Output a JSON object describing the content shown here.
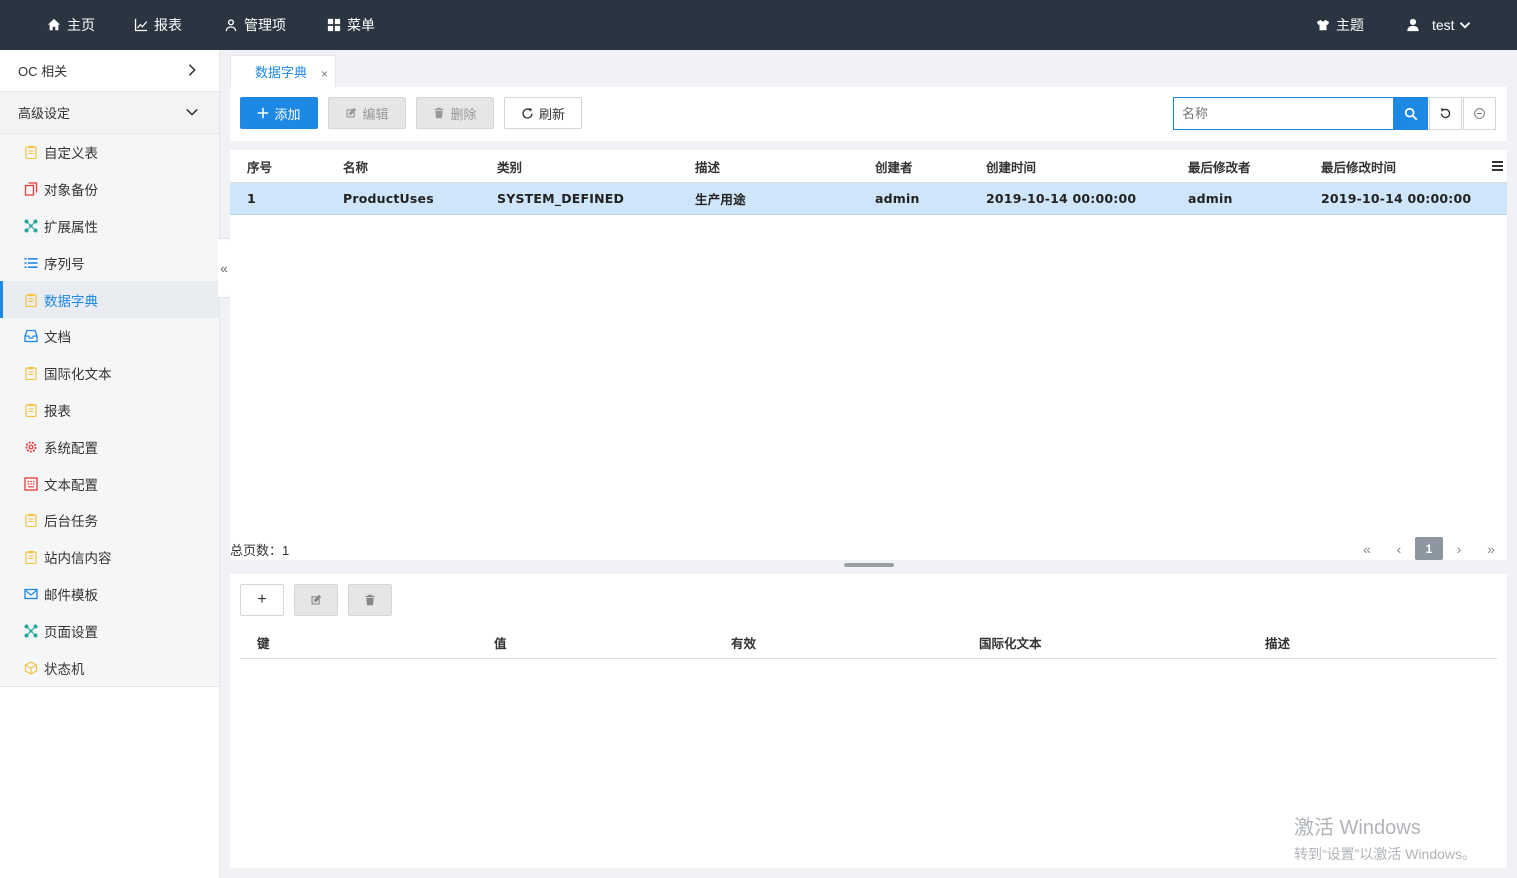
{
  "topnav": {
    "home": "主页",
    "reports": "报表",
    "admin": "管理项",
    "menu": "菜单",
    "theme": "主题",
    "user": "test"
  },
  "sidebar": {
    "group_oc": "OC 相关",
    "group_advanced": "高级设定",
    "items": [
      {
        "label": "自定义表",
        "icon": "clipboard-icon",
        "color": "#f5c242"
      },
      {
        "label": "对象备份",
        "icon": "copy-icon",
        "color": "#e53935"
      },
      {
        "label": "扩展属性",
        "icon": "network-icon",
        "color": "#26a69a"
      },
      {
        "label": "序列号",
        "icon": "list-icon",
        "color": "#1e88e5"
      },
      {
        "label": "数据字典",
        "icon": "clipboard-icon",
        "color": "#f5c242"
      },
      {
        "label": "文档",
        "icon": "inbox-icon",
        "color": "#1e88e5"
      },
      {
        "label": "国际化文本",
        "icon": "clipboard-icon",
        "color": "#f5c242"
      },
      {
        "label": "报表",
        "icon": "clipboard-icon",
        "color": "#f5c242"
      },
      {
        "label": "系统配置",
        "icon": "gear-icon",
        "color": "#e53935"
      },
      {
        "label": "文本配置",
        "icon": "keyboard-icon",
        "color": "#e53935"
      },
      {
        "label": "后台任务",
        "icon": "clipboard-icon",
        "color": "#f5c242"
      },
      {
        "label": "站内信内容",
        "icon": "clipboard-icon",
        "color": "#f5c242"
      },
      {
        "label": "邮件模板",
        "icon": "mail-icon",
        "color": "#1e88e5"
      },
      {
        "label": "页面设置",
        "icon": "network-icon",
        "color": "#26a69a"
      },
      {
        "label": "状态机",
        "icon": "cube-icon",
        "color": "#f5c242"
      }
    ],
    "active_index": 4,
    "collapse_glyph": "«"
  },
  "tab": {
    "label": "数据字典",
    "close": "×"
  },
  "toolbar": {
    "add": "添加",
    "edit": "编辑",
    "delete": "删除",
    "refresh": "刷新",
    "search_placeholder": "名称"
  },
  "grid": {
    "columns": [
      "序号",
      "名称",
      "类别",
      "描述",
      "创建者",
      "创建时间",
      "最后修改者",
      "最后修改时间"
    ],
    "rows": [
      [
        "1",
        "ProductUses",
        "SYSTEM_DEFINED",
        "生产用途",
        "admin",
        "2019-10-14 00:00:00",
        "admin",
        "2019-10-14 00:00:00"
      ]
    ]
  },
  "pager": {
    "total_label": "总页数：1",
    "first": "«",
    "prev": "‹",
    "current": "1",
    "next": "›",
    "last": "»"
  },
  "detail_grid": {
    "add": "+",
    "columns": [
      "键",
      "值",
      "有效",
      "国际化文本",
      "描述"
    ]
  },
  "watermark": {
    "line1": "激活 Windows",
    "line2": "转到“设置”以激活 Windows。"
  },
  "colors": {
    "topbar": "#2b3441",
    "accent": "#1e88e5",
    "selected_row": "#cfe5fa"
  }
}
